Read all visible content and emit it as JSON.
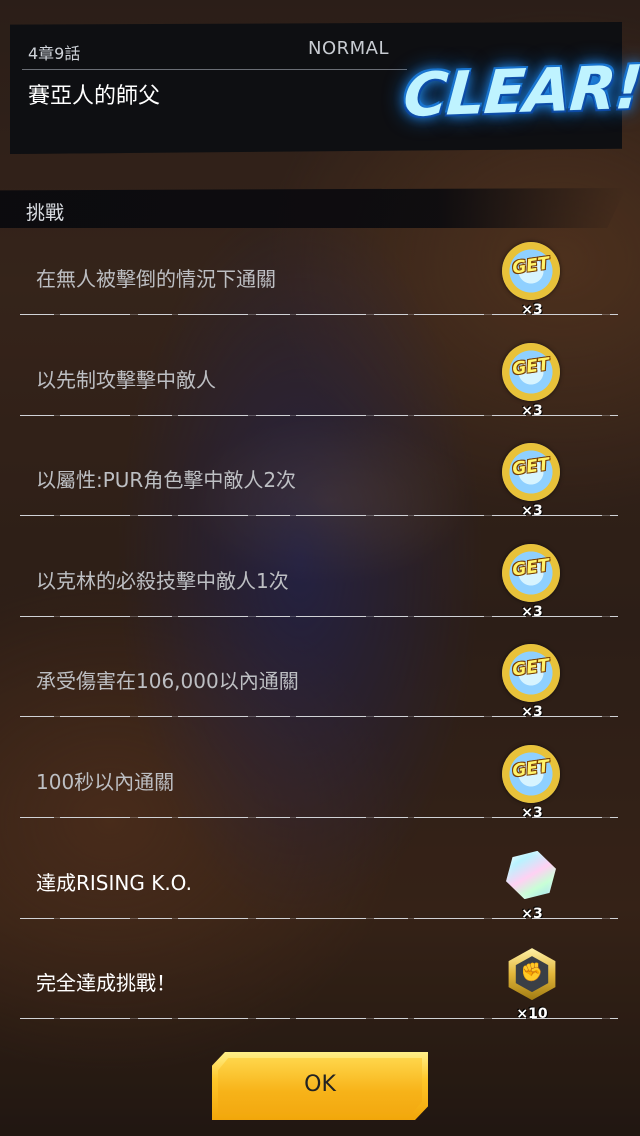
{
  "header": {
    "chapter": "4章9話",
    "difficulty": "NORMAL",
    "stage_title": "賽亞人的師父",
    "clear_text": "CLEAR!"
  },
  "section": {
    "label": "挑戰"
  },
  "challenges": [
    {
      "text": "在無人被擊倒的情況下通關",
      "reward": "get-coin-icon",
      "reward_label": "GET",
      "quantity": "×3",
      "status": "completed"
    },
    {
      "text": "以先制攻擊擊中敵人",
      "reward": "get-coin-icon",
      "reward_label": "GET",
      "quantity": "×3",
      "status": "completed"
    },
    {
      "text": "以屬性:PUR角色擊中敵人2次",
      "reward": "get-coin-icon",
      "reward_label": "GET",
      "quantity": "×3",
      "status": "completed"
    },
    {
      "text": "以克林的必殺技擊中敵人1次",
      "reward": "get-coin-icon",
      "reward_label": "GET",
      "quantity": "×3",
      "status": "completed"
    },
    {
      "text": "承受傷害在106,000以內通關",
      "reward": "get-coin-icon",
      "reward_label": "GET",
      "quantity": "×3",
      "status": "completed"
    },
    {
      "text": "100秒以內通關",
      "reward": "get-coin-icon",
      "reward_label": "GET",
      "quantity": "×3",
      "status": "completed"
    },
    {
      "text": "達成RISING K.O.",
      "reward": "chrono-crystal-icon",
      "quantity": "×3",
      "status": "new"
    },
    {
      "text": "完全達成挑戰！",
      "reward": "fist-medal-icon",
      "quantity": "×10",
      "status": "new"
    }
  ],
  "ok_button": {
    "label": "OK"
  },
  "colors": {
    "accent_gold": "#f7b319",
    "clear_blue": "#2b9bff"
  }
}
